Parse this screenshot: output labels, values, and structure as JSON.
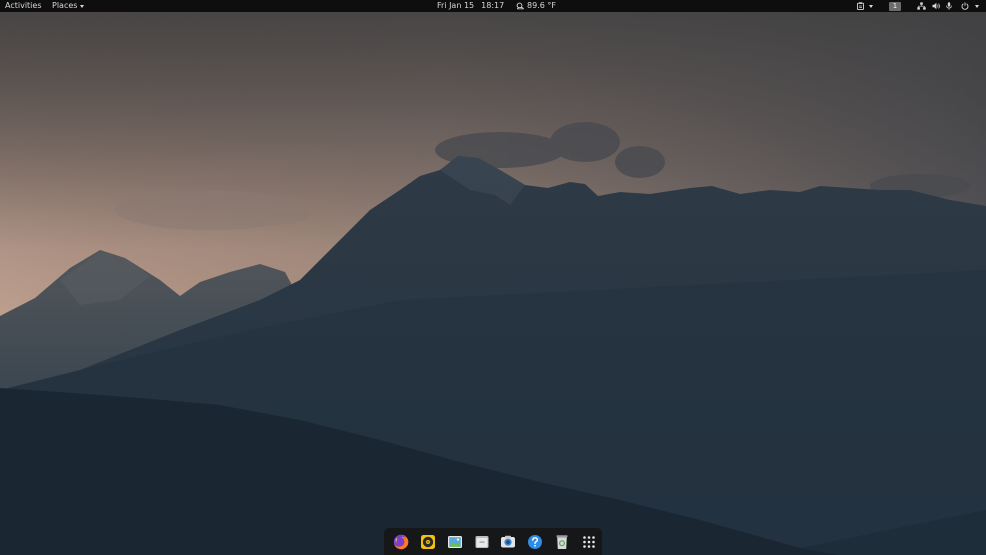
{
  "topbar": {
    "activities_label": "Activities",
    "places_label": "Places",
    "date": "Fri Jan 15",
    "time": "18:17",
    "weather_temp": "89.6 °F",
    "workspace_number": "1",
    "icons": [
      "clipboard-icon",
      "network-icon",
      "volume-icon",
      "microphone-icon",
      "power-icon"
    ]
  },
  "dock": {
    "items": [
      {
        "name": "firefox",
        "icon": "firefox-icon"
      },
      {
        "name": "rhythmbox",
        "icon": "music-player-icon"
      },
      {
        "name": "image-viewer",
        "icon": "image-viewer-icon"
      },
      {
        "name": "files",
        "icon": "files-icon"
      },
      {
        "name": "screenshot",
        "icon": "camera-icon"
      },
      {
        "name": "help",
        "icon": "help-icon"
      },
      {
        "name": "trash",
        "icon": "trash-icon"
      },
      {
        "name": "show-applications",
        "icon": "app-grid-icon"
      }
    ]
  },
  "colors": {
    "topbar_bg": "#0e0e0e",
    "dock_bg": "#161616",
    "sky_top": "#4b4a4a",
    "sky_glow": "#c8a996",
    "mountain_far": "#37424c",
    "mountain_mid": "#243442",
    "mountain_near": "#1c2a36"
  }
}
